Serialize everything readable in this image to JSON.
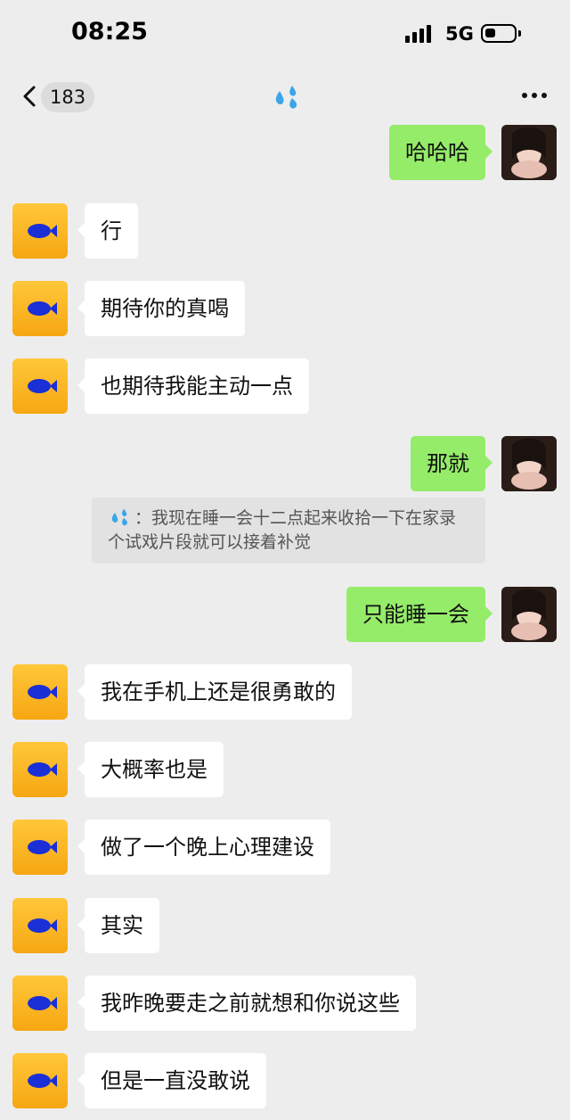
{
  "status_bar": {
    "time": "08:25",
    "network": "5G"
  },
  "nav": {
    "back_count": "183",
    "title_icon": "sweat-droplets-emoji",
    "more_icon": "more-dots-icon"
  },
  "colors": {
    "background": "#ededed",
    "self_bubble": "#95ec69",
    "other_bubble": "#ffffff",
    "other_avatar": "#f6a712",
    "fish_icon": "#1a2fd6"
  },
  "messages": [
    {
      "side": "right",
      "text": "哈哈哈"
    },
    {
      "side": "left",
      "text": "行"
    },
    {
      "side": "left",
      "text": "期待你的真喝"
    },
    {
      "side": "left",
      "text": "也期待我能主动一点"
    },
    {
      "side": "right",
      "text": "那就"
    },
    {
      "side": "right",
      "text": "只能睡一会"
    },
    {
      "side": "left",
      "text": "我在手机上还是很勇敢的"
    },
    {
      "side": "left",
      "text": "大概率也是"
    },
    {
      "side": "left",
      "text": "做了一个晚上心理建设"
    },
    {
      "side": "left",
      "text": "其实"
    },
    {
      "side": "left",
      "text": "我昨晚要走之前就想和你说这些"
    },
    {
      "side": "left",
      "text": "但是一直没敢说"
    }
  ],
  "quote": {
    "prefix": "：",
    "text": "我现在睡一会十二点起来收拾一下在家录个试戏片段就可以接着补觉"
  }
}
